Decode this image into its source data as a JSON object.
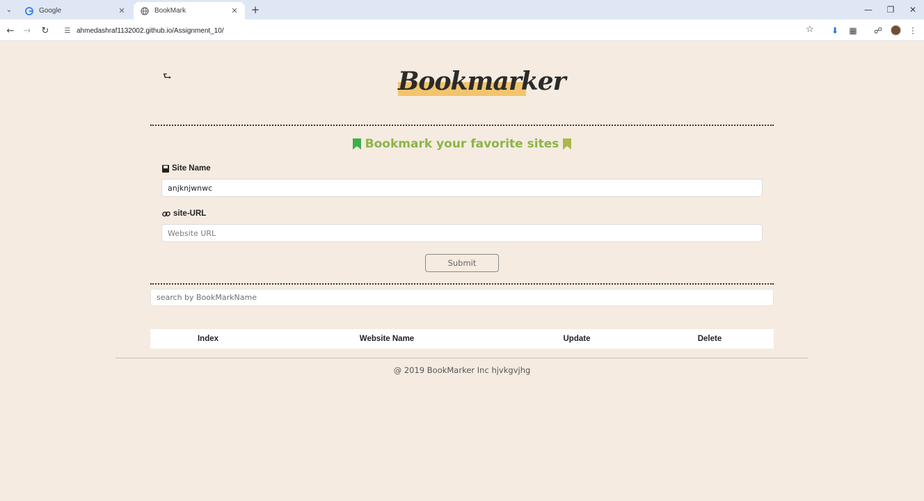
{
  "browser": {
    "tabs": [
      {
        "title": "Google",
        "active": false
      },
      {
        "title": "BookMark",
        "active": true
      }
    ],
    "url": "ahmedashraf1132002.github.io/Assignment_10/"
  },
  "page": {
    "logo": "Bookmarker",
    "subtitle": "Bookmark your favorite sites",
    "site_name_label": "Site Name",
    "site_name_value": "anjknjwnwc",
    "site_url_label": "site-URL",
    "site_url_placeholder": "Website URL",
    "submit_label": "Submit",
    "search_placeholder": "search by BookMarkName",
    "table_headers": [
      "Index",
      "Website Name",
      "Update",
      "Delete"
    ],
    "footer": "@ 2019 BookMarker Inc hjvkgvjhg"
  },
  "colors": {
    "background": "#f5ebe0",
    "accent_green": "#8bb548",
    "logo_highlight": "#f2c46d",
    "bookmark_icon": "#3fae49"
  }
}
